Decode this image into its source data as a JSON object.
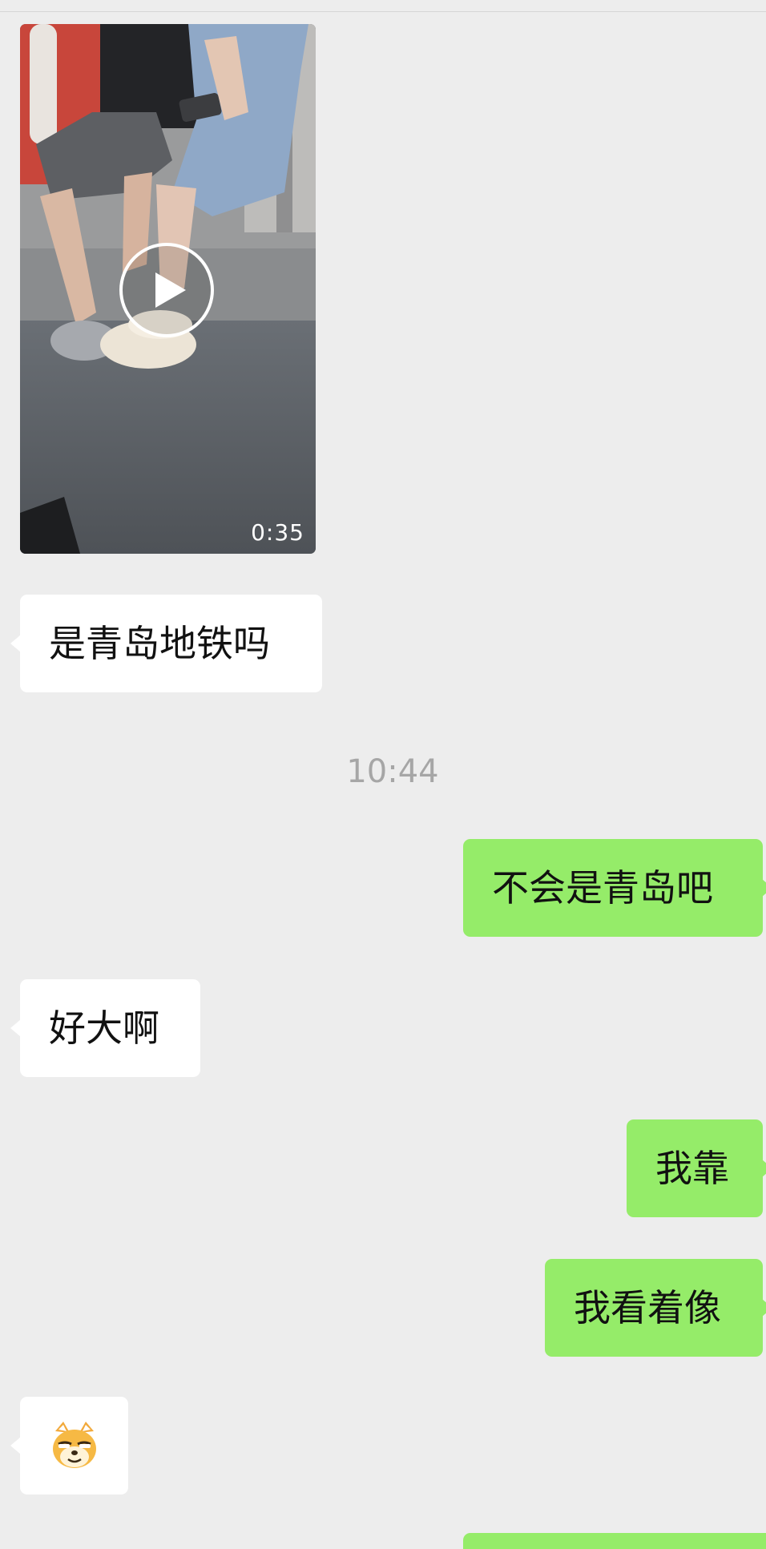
{
  "video": {
    "duration": "0:35"
  },
  "messages": [
    {
      "side": "in",
      "text": "是青岛地铁吗"
    },
    {
      "side": "out",
      "text": "不会是青岛吧"
    },
    {
      "side": "in",
      "text": "好大啊"
    },
    {
      "side": "out",
      "text": "我靠"
    },
    {
      "side": "out",
      "text": "我看着像"
    }
  ],
  "timestamp": "10:44",
  "sticker": {
    "icon": "doge-smirk-emoji-icon"
  },
  "colors": {
    "background": "#ededed",
    "incoming_bubble": "#ffffff",
    "outgoing_bubble": "#95ec69",
    "timestamp_text": "#a6a6a6"
  }
}
